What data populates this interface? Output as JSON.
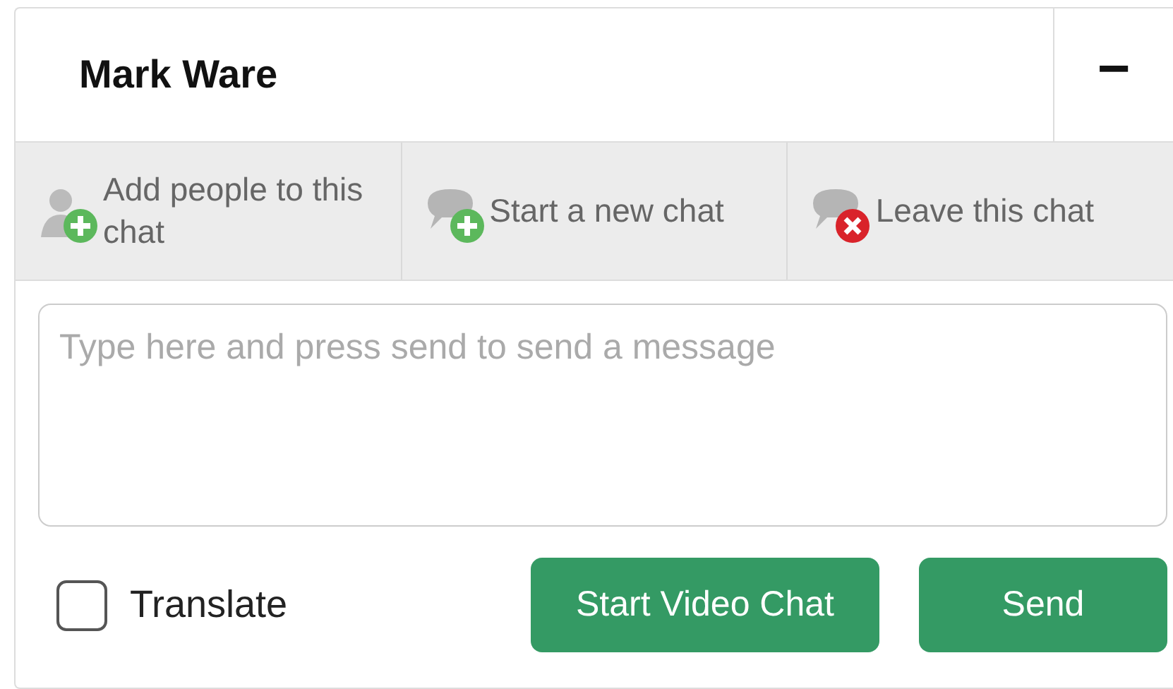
{
  "header": {
    "title": "Mark Ware",
    "minimize": "−"
  },
  "actions": [
    {
      "kind": "add-person",
      "label": "Add people to this chat"
    },
    {
      "kind": "new-chat",
      "label": "Start a new chat"
    },
    {
      "kind": "leave",
      "label": "Leave this chat"
    }
  ],
  "message": {
    "placeholder": "Type here and press send to send a message"
  },
  "translate": {
    "label": "Translate",
    "checked": false
  },
  "buttons": [
    "Start Video Chat",
    "Send"
  ]
}
